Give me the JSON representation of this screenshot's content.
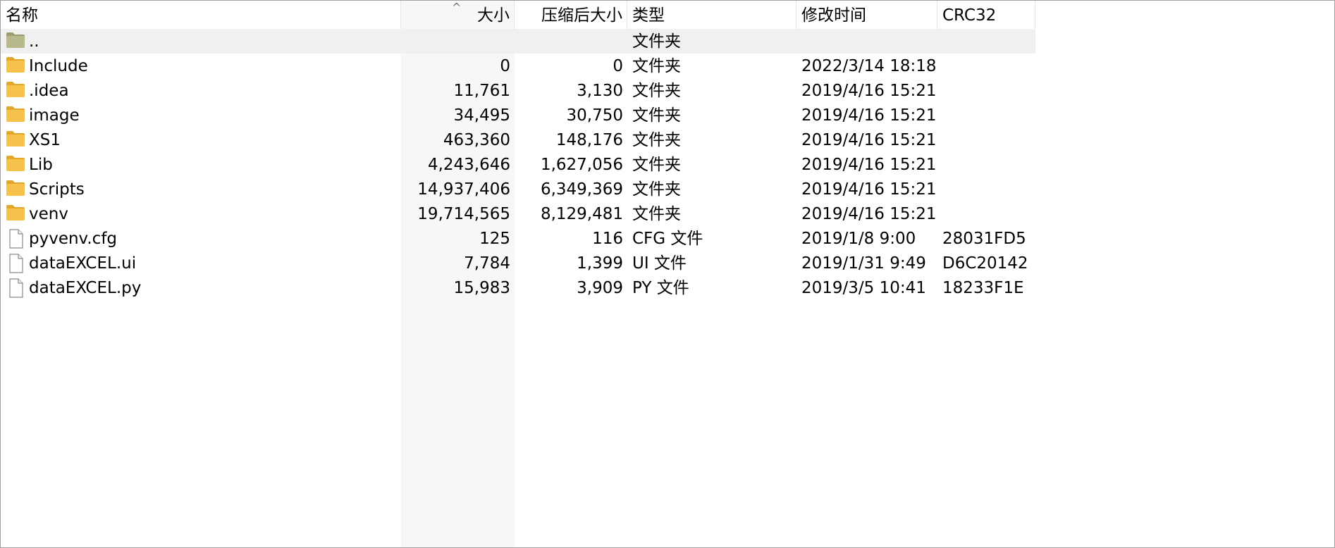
{
  "columns": {
    "name": "名称",
    "size": "大小",
    "packed": "压缩后大小",
    "type": "类型",
    "modified": "修改时间",
    "crc": "CRC32",
    "sort_indicator": "^"
  },
  "rows": [
    {
      "icon": "parent-folder-icon",
      "name": "..",
      "size": "",
      "packed": "",
      "type": "文件夹",
      "modified": "",
      "crc": ""
    },
    {
      "icon": "folder-icon",
      "name": "Include",
      "size": "0",
      "packed": "0",
      "type": "文件夹",
      "modified": "2022/3/14 18:18",
      "crc": ""
    },
    {
      "icon": "folder-icon",
      "name": ".idea",
      "size": "11,761",
      "packed": "3,130",
      "type": "文件夹",
      "modified": "2019/4/16 15:21",
      "crc": ""
    },
    {
      "icon": "folder-icon",
      "name": "image",
      "size": "34,495",
      "packed": "30,750",
      "type": "文件夹",
      "modified": "2019/4/16 15:21",
      "crc": ""
    },
    {
      "icon": "folder-icon",
      "name": "XS1",
      "size": "463,360",
      "packed": "148,176",
      "type": "文件夹",
      "modified": "2019/4/16 15:21",
      "crc": ""
    },
    {
      "icon": "folder-icon",
      "name": "Lib",
      "size": "4,243,646",
      "packed": "1,627,056",
      "type": "文件夹",
      "modified": "2019/4/16 15:21",
      "crc": ""
    },
    {
      "icon": "folder-icon",
      "name": "Scripts",
      "size": "14,937,406",
      "packed": "6,349,369",
      "type": "文件夹",
      "modified": "2019/4/16 15:21",
      "crc": ""
    },
    {
      "icon": "folder-icon",
      "name": "venv",
      "size": "19,714,565",
      "packed": "8,129,481",
      "type": "文件夹",
      "modified": "2019/4/16 15:21",
      "crc": ""
    },
    {
      "icon": "file-icon",
      "name": "pyvenv.cfg",
      "size": "125",
      "packed": "116",
      "type": "CFG 文件",
      "modified": "2019/1/8 9:00",
      "crc": "28031FD5"
    },
    {
      "icon": "file-icon",
      "name": "dataEXCEL.ui",
      "size": "7,784",
      "packed": "1,399",
      "type": "UI 文件",
      "modified": "2019/1/31 9:49",
      "crc": "D6C20142"
    },
    {
      "icon": "file-icon",
      "name": "dataEXCEL.py",
      "size": "15,983",
      "packed": "3,909",
      "type": "PY 文件",
      "modified": "2019/3/5 10:41",
      "crc": "18233F1E"
    }
  ],
  "colors": {
    "folder": "#f5c34b",
    "folder_dark": "#e2a72b",
    "parent_folder": "#b7b98a",
    "size_column_bg": "#f7f7f7",
    "parent_row_bg": "#f0f0f0"
  }
}
